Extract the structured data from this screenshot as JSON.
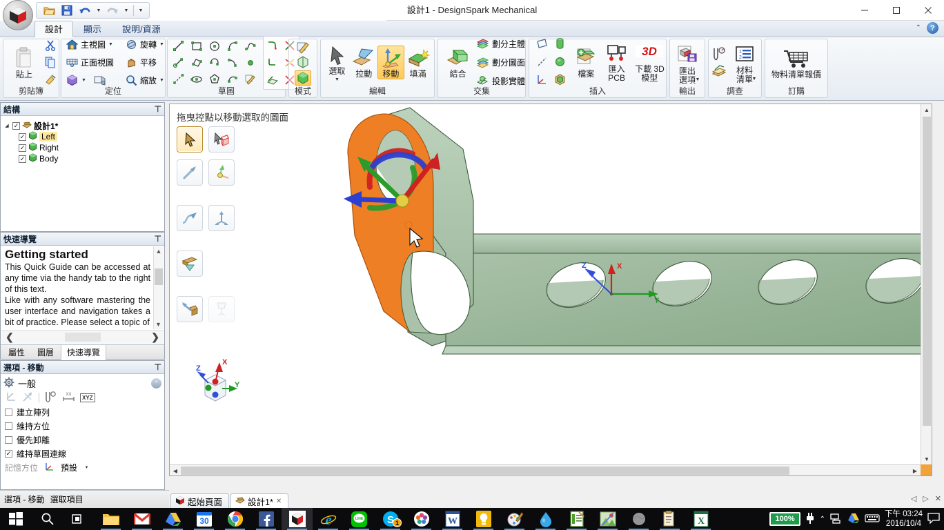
{
  "window": {
    "title": "設計1 - DesignSpark Mechanical",
    "minimize": "–",
    "maximize": "▢",
    "close": "✕"
  },
  "quick_access": {
    "items": [
      {
        "name": "open-icon",
        "label": "開啟"
      },
      {
        "name": "save-icon",
        "label": "儲存"
      },
      {
        "name": "undo-icon",
        "label": "復原"
      },
      {
        "name": "redo-icon",
        "label": "重做"
      },
      {
        "name": "customize-qat-icon",
        "label": "自訂快速存取工具列"
      }
    ]
  },
  "ribbon": {
    "tabs": [
      {
        "label": "設計",
        "active": true
      },
      {
        "label": "顯示",
        "active": false
      },
      {
        "label": "說明/資源",
        "active": false
      }
    ],
    "help_icons": [
      {
        "name": "minimize-ribbon-icon",
        "glyph": "⌃"
      },
      {
        "name": "help-icon",
        "glyph": "?"
      }
    ],
    "groups": [
      {
        "name": "clipboard",
        "label": "剪貼簿",
        "paste_label": "貼上",
        "items": [
          {
            "label": "剪下",
            "name": "cut-icon"
          },
          {
            "label": "複製",
            "name": "copy-icon"
          },
          {
            "label": "複製格式",
            "name": "format-painter-icon"
          }
        ]
      },
      {
        "name": "orient",
        "label": "定位",
        "items": [
          {
            "label": "主視圖",
            "name": "home-view-icon",
            "dropdown": true
          },
          {
            "label": "旋轉",
            "name": "spin-icon",
            "dropdown": true
          },
          {
            "label": "正面視圖",
            "name": "plan-view-icon",
            "dropdown": false
          },
          {
            "label": "平移",
            "name": "pan-icon",
            "dropdown": false
          },
          {
            "label": "",
            "name": "isometric-view-icon",
            "dropdown": true
          },
          {
            "label": "",
            "name": "view-mode-icon",
            "dropdown": false
          },
          {
            "label": "縮放",
            "name": "zoom-icon",
            "dropdown": true
          }
        ]
      },
      {
        "name": "sketch",
        "label": "草圖",
        "tools": [
          "line-icon",
          "rectangle-icon",
          "circle-icon",
          "tangent-arc-icon",
          "spline-icon",
          "construction-line-icon",
          "three-point-rectangle-icon",
          "three-point-arc-icon",
          "sweep-arc-icon",
          "point-icon",
          "polyline-icon",
          "ellipse-icon",
          "polygon-icon",
          "arc-icon",
          "sketch-pencil-icon"
        ],
        "modifiers": [
          "trim-corner-icon",
          "split-icon",
          "fillet-corner-icon",
          "trim-away-icon",
          "project-icon",
          "break-icon"
        ]
      },
      {
        "name": "mode",
        "label": "模式",
        "items": [
          "sketch-mode-icon",
          "section-mode-icon",
          "solid-mode-icon"
        ]
      },
      {
        "name": "edit",
        "label": "編輯",
        "items": [
          {
            "label": "選取",
            "name": "select-tool",
            "dropdown": true,
            "selected": false
          },
          {
            "label": "拉動",
            "name": "pull-tool",
            "dropdown": false,
            "selected": false
          },
          {
            "label": "移動",
            "name": "move-tool",
            "dropdown": false,
            "selected": true
          },
          {
            "label": "填滿",
            "name": "fill-tool",
            "dropdown": false,
            "selected": false
          }
        ]
      },
      {
        "name": "intersect",
        "label": "交集",
        "combine_label": "結合",
        "items": [
          {
            "label": "劃分主體",
            "name": "split-body-icon"
          },
          {
            "label": "劃分圖面",
            "name": "split-face-icon"
          },
          {
            "label": "投影實體",
            "name": "project-solid-icon"
          }
        ]
      },
      {
        "name": "insert",
        "label": "插入",
        "icons": [
          "plane-icon",
          "axis-icon",
          "point-icon-2",
          "cylinder-icon",
          "sphere-icon",
          "solid-primitive-icon"
        ],
        "items": [
          {
            "label": "檔案",
            "name": "insert-file"
          },
          {
            "label": "匯入\nPCB",
            "name": "import-pcb"
          },
          {
            "label": "下載 3D\n模型",
            "name": "download-3d-model"
          }
        ]
      },
      {
        "name": "output",
        "label": "輸出",
        "items": [
          {
            "label": "匯出\n選項",
            "name": "export-options",
            "dropdown": true
          }
        ]
      },
      {
        "name": "survey",
        "label": "調查",
        "icons": [
          "measure-icon",
          "bom-table-icon",
          "mass-properties-icon"
        ],
        "items": [
          {
            "label": "材料\n清單",
            "name": "bill-of-materials",
            "dropdown": true
          }
        ]
      },
      {
        "name": "order",
        "label": "訂購",
        "items": [
          {
            "label": "物料清單報價",
            "name": "bom-quote"
          }
        ]
      }
    ]
  },
  "structure_panel": {
    "title": "結構",
    "pin": "⊤",
    "root": {
      "label": "設計1*",
      "checked": true
    },
    "children": [
      {
        "label": "Left",
        "checked": true,
        "highlighted": true
      },
      {
        "label": "Right",
        "checked": true,
        "highlighted": false
      },
      {
        "label": "Body",
        "checked": true,
        "highlighted": false
      }
    ]
  },
  "quickguide_panel": {
    "title": "快速導覽",
    "pin": "⊤",
    "heading": "Getting started",
    "paragraph1": "This Quick Guide can be accessed at any time via the handy tab to the right of this text.",
    "paragraph2": "Like with any software mastering the user interface and navigation takes a bit of practice. Please select a topic of",
    "prev": "❮",
    "next": "❯",
    "tabs": [
      {
        "label": "屬性",
        "active": false
      },
      {
        "label": "圖層",
        "active": false
      },
      {
        "label": "快速導覽",
        "active": true
      }
    ]
  },
  "options_panel": {
    "title": "選項 - 移動",
    "pin": "⊤",
    "section": "一般",
    "collapse": "⌃",
    "tool_icons": [
      "move-direction-icon",
      "anchor-icon",
      "ruler-icon",
      "measure-dim-icon",
      "xyz-icon"
    ],
    "xyz_label": "XYZ",
    "checkboxes": [
      {
        "label": "建立陣列",
        "checked": false
      },
      {
        "label": "維持方位",
        "checked": false
      },
      {
        "label": "優先卸離",
        "checked": false
      },
      {
        "label": "維持草圖連線",
        "checked": true
      }
    ],
    "memory_label": "記憶方位",
    "memory_value": "預設",
    "memory_caret": "▾"
  },
  "viewport": {
    "hint": "拖曳控點以移動選取的圖面",
    "tools": [
      [
        {
          "name": "select-arrow-tool",
          "selected": true
        },
        {
          "name": "select-box-tool",
          "selected": false
        }
      ],
      [
        {
          "name": "move-direction-arrow-tool",
          "selected": false
        },
        {
          "name": "move-origin-tool",
          "selected": false
        }
      ],
      [
        {
          "name": "move-along-curve-tool",
          "selected": false
        },
        {
          "name": "move-multiple-tool",
          "selected": false
        }
      ],
      [
        {
          "name": "move-sketch-tool",
          "selected": false
        }
      ],
      [
        {
          "name": "detach-tool",
          "selected": false
        },
        {
          "name": "cleanup-tool",
          "selected": false,
          "disabled": true
        }
      ]
    ],
    "axis_triad": {
      "x": "X",
      "y": "Y",
      "z": "Z"
    },
    "model_axis": {
      "x": "X",
      "y": "Y",
      "z": "Z"
    },
    "colors": {
      "selected_face": "#ef7f24",
      "body": "#9cb79c",
      "body_dark": "#7f9a7f",
      "body_light": "#c2d4c2",
      "handle_x": "#cc2222",
      "handle_y": "#2b9b2b",
      "handle_z": "#2b3fd0",
      "handle_origin": "#e3cc46"
    }
  },
  "doc_tabs": [
    {
      "label": "起始頁面",
      "name": "start-page-tab",
      "active": false,
      "closable": false
    },
    {
      "label": "設計1*",
      "name": "design1-tab",
      "active": true,
      "closable": true
    }
  ],
  "status_bar": {
    "tabs": [
      {
        "label": "選項 - 移動",
        "active": true
      },
      {
        "label": "選取項目",
        "active": false
      }
    ],
    "nav": [
      "◁",
      "▷",
      "✕"
    ]
  },
  "taskbar": {
    "start": "start-icon",
    "search": "search-icon",
    "taskview": "task-view-icon",
    "apps": [
      {
        "name": "file-explorer-icon",
        "running": true,
        "active": false
      },
      {
        "name": "gmail-icon",
        "running": true,
        "active": false
      },
      {
        "name": "google-drive-icon",
        "running": true,
        "active": false
      },
      {
        "name": "calendar-icon",
        "running": true,
        "active": false,
        "label": "30"
      },
      {
        "name": "chrome-icon",
        "running": true,
        "active": false
      },
      {
        "name": "facebook-icon",
        "running": true,
        "active": false
      },
      {
        "name": "designspark-icon",
        "running": true,
        "active": true
      },
      {
        "name": "internet-explorer-icon",
        "running": true,
        "active": false
      },
      {
        "name": "line-icon",
        "running": true,
        "active": false,
        "label": "LINE"
      },
      {
        "name": "skype-icon",
        "running": true,
        "active": false,
        "badge": "1"
      },
      {
        "name": "photos-icon",
        "running": true,
        "active": false
      },
      {
        "name": "word-icon",
        "running": true,
        "active": false,
        "label": "W"
      },
      {
        "name": "lightbulb-icon",
        "running": true,
        "active": false
      },
      {
        "name": "paint-icon",
        "running": true,
        "active": false
      },
      {
        "name": "water-drop-icon",
        "running": true,
        "active": false
      },
      {
        "name": "notepad-icon",
        "running": true,
        "active": false
      },
      {
        "name": "image-viewer-icon",
        "running": true,
        "active": false
      },
      {
        "name": "grayscale-app-icon",
        "running": true,
        "active": false
      },
      {
        "name": "clipboard-app-icon",
        "running": true,
        "active": false
      },
      {
        "name": "excel-icon",
        "running": true,
        "active": false,
        "label": "X"
      }
    ],
    "tray": {
      "battery": "100%",
      "power_icon": "power-plug-icon",
      "show_hidden": "show-hidden-icons-icon",
      "network_icon": "network-icon",
      "drive_icon": "google-drive-tray-icon",
      "keyboard_icon": "keyboard-icon",
      "time": "下午 03:24",
      "date": "2016/10/4",
      "notifications": "notification-icon"
    }
  }
}
